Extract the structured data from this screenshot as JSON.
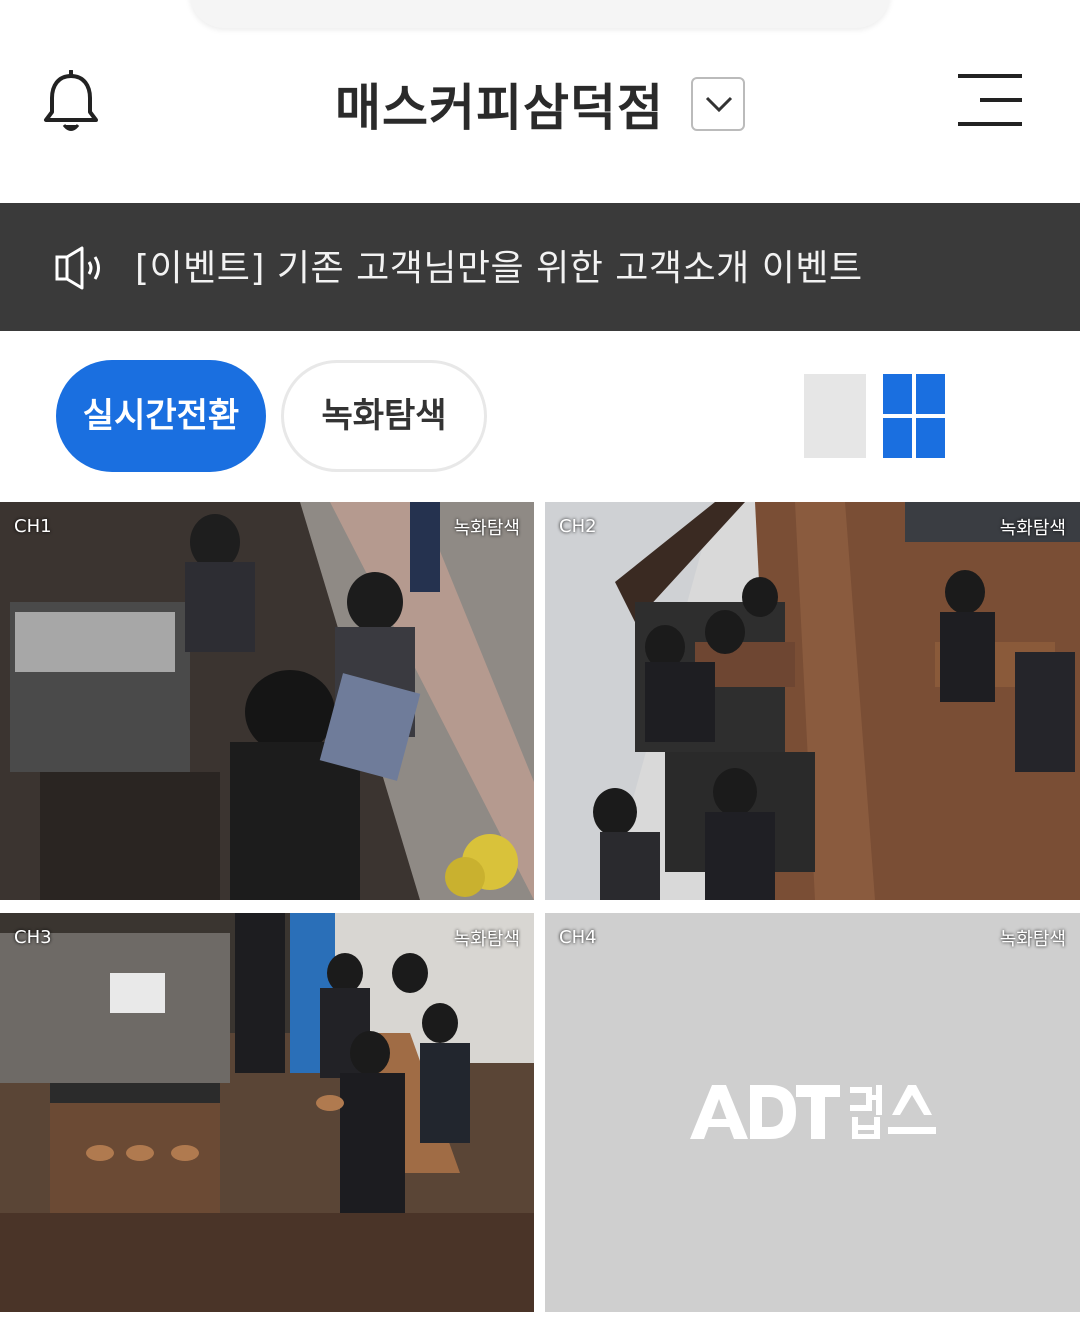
{
  "header": {
    "store_name": "매스커피삼덕점",
    "bell_icon": "bell-icon",
    "dropdown_icon": "chevron-down-icon",
    "menu_icon": "hamburger-menu-icon"
  },
  "notice": {
    "icon": "speaker-icon",
    "text": "[이벤트] 기존 고객님만을 위한 고객소개 이벤트"
  },
  "mode_buttons": {
    "live_label": "실시간전환",
    "recording_label": "녹화탐색"
  },
  "layout_toggle": {
    "single_icon": "single-view-icon",
    "quad_icon": "quad-view-icon",
    "active": "quad"
  },
  "cameras": [
    {
      "channel": "CH1",
      "recording_label": "녹화탐색"
    },
    {
      "channel": "CH2",
      "recording_label": "녹화탐색"
    },
    {
      "channel": "CH3",
      "recording_label": "녹화탐색"
    },
    {
      "channel": "CH4",
      "recording_label": "녹화탐색",
      "placeholder_logo": "ADT 캡스"
    }
  ],
  "colors": {
    "accent": "#1a6fe0",
    "notice_bg": "#3a3a3a",
    "empty_tile": "#cfcfcf"
  }
}
